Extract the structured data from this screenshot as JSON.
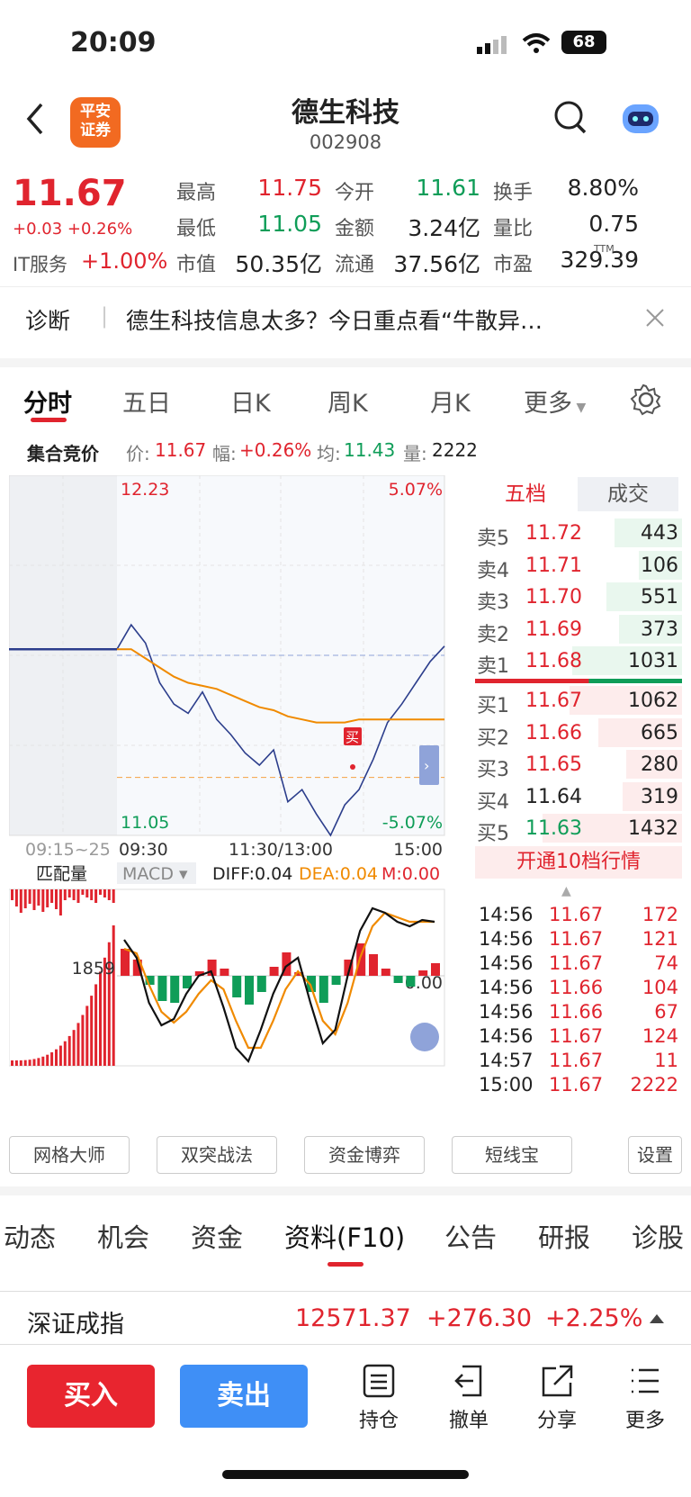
{
  "status_bar": {
    "time": "20:09",
    "battery": "68"
  },
  "header": {
    "back_icon": "chevron-left-icon",
    "logo_text_top": "平安",
    "logo_text_bottom": "证券",
    "title": "德生科技",
    "code": "002908",
    "search_icon": "search-icon",
    "assistant_icon": "robot-icon"
  },
  "quote": {
    "price": "11.67",
    "change": "+0.03",
    "change_pct": "+0.26%",
    "sector": "IT服务",
    "sector_pct": "+1.00%",
    "fields": [
      {
        "label": "最高",
        "value": "11.75",
        "color": "red"
      },
      {
        "label": "今开",
        "value": "11.61",
        "color": "green"
      },
      {
        "label": "换手",
        "value": "8.80%",
        "color": "blk"
      },
      {
        "label": "最低",
        "value": "11.05",
        "color": "green"
      },
      {
        "label": "金额",
        "value": "3.24亿",
        "color": "blk"
      },
      {
        "label": "量比",
        "value": "0.75",
        "color": "blk"
      },
      {
        "label": "市值",
        "value": "50.35亿",
        "color": "blk"
      },
      {
        "label": "流通",
        "value": "37.56亿",
        "color": "blk"
      },
      {
        "label": "市盈",
        "value": "329.39",
        "color": "blk"
      }
    ],
    "pe_suffix": "TTM"
  },
  "diagnosis": {
    "label": "诊断",
    "text": "德生科技信息太多？今日重点看“牛散异…",
    "close_icon": "close-icon"
  },
  "chart_tabs": [
    "分时",
    "五日",
    "日K",
    "周K",
    "月K",
    "更多"
  ],
  "settings_icon": "gear-icon",
  "auction": {
    "label": "集合竞价",
    "price_label": "价:",
    "price": "11.67",
    "amp_label": "幅:",
    "amp": "+0.26%",
    "avg_label": "均:",
    "avg": "11.43",
    "vol_label": "量:",
    "vol": "2222"
  },
  "chart_data": {
    "type": "line",
    "price_top": "12.23",
    "price_bottom": "11.05",
    "pct_top": "5.07%",
    "pct_bottom": "-5.07%",
    "x_labels": [
      "09:15~25",
      "09:30",
      "11:30/13:00",
      "15:00"
    ],
    "prev_close": 11.64,
    "series": [
      {
        "values": [
          11.66,
          11.74,
          11.68,
          11.55,
          11.48,
          11.45,
          11.52,
          11.43,
          11.38,
          11.32,
          11.28,
          11.33,
          11.16,
          11.2,
          11.12,
          11.05,
          11.15,
          11.2,
          11.3,
          11.42,
          11.48,
          11.55,
          11.62,
          11.67
        ]
      },
      {
        "values": [
          11.66,
          11.66,
          11.63,
          11.6,
          11.57,
          11.55,
          11.54,
          11.53,
          11.51,
          11.49,
          11.47,
          11.46,
          11.44,
          11.43,
          11.42,
          11.42,
          11.42,
          11.43,
          11.43,
          11.43,
          11.43,
          11.43,
          11.43,
          11.43
        ]
      }
    ],
    "buy_marker": "买",
    "match_label": "匹配量",
    "macd_label": "MACD",
    "diff": "DIFF:0.04",
    "dea": "DEA:0.04",
    "m": "M:0.00",
    "macd_mid_label": "1859",
    "macd_zero": "0.00"
  },
  "book": {
    "tabs": [
      "五档",
      "成交"
    ],
    "asks": [
      {
        "label": "卖5",
        "price": "11.72",
        "vol": "443"
      },
      {
        "label": "卖4",
        "price": "11.71",
        "vol": "106"
      },
      {
        "label": "卖3",
        "price": "11.70",
        "vol": "551"
      },
      {
        "label": "卖2",
        "price": "11.69",
        "vol": "373"
      },
      {
        "label": "卖1",
        "price": "11.68",
        "vol": "1031"
      }
    ],
    "bids": [
      {
        "label": "买1",
        "price": "11.67",
        "vol": "1062"
      },
      {
        "label": "买2",
        "price": "11.66",
        "vol": "665"
      },
      {
        "label": "买3",
        "price": "11.65",
        "vol": "280"
      },
      {
        "label": "买4",
        "price": "11.64",
        "vol": "319"
      },
      {
        "label": "买5",
        "price": "11.63",
        "vol": "1432"
      }
    ],
    "upgrade": "开通10档行情",
    "ticks": [
      {
        "time": "14:56",
        "price": "11.67",
        "vol": "172"
      },
      {
        "time": "14:56",
        "price": "11.67",
        "vol": "121"
      },
      {
        "time": "14:56",
        "price": "11.67",
        "vol": "74"
      },
      {
        "time": "14:56",
        "price": "11.66",
        "vol": "104"
      },
      {
        "time": "14:56",
        "price": "11.66",
        "vol": "67"
      },
      {
        "time": "14:56",
        "price": "11.67",
        "vol": "124"
      },
      {
        "time": "14:57",
        "price": "11.67",
        "vol": "11"
      },
      {
        "time": "15:00",
        "price": "11.67",
        "vol": "2222"
      }
    ]
  },
  "tools": [
    "网格大师",
    "双突战法",
    "资金博弈",
    "短线宝",
    "设置"
  ],
  "sub_tabs": [
    "动态",
    "机会",
    "资金",
    "资料(F10)",
    "公告",
    "研报",
    "诊股"
  ],
  "index": {
    "name": "深证成指",
    "value": "12571.37",
    "change": "+276.30",
    "pct": "+2.25%"
  },
  "bottom": {
    "buy": "买入",
    "sell": "卖出",
    "actions": [
      "持仓",
      "撤单",
      "分享",
      "更多"
    ]
  }
}
